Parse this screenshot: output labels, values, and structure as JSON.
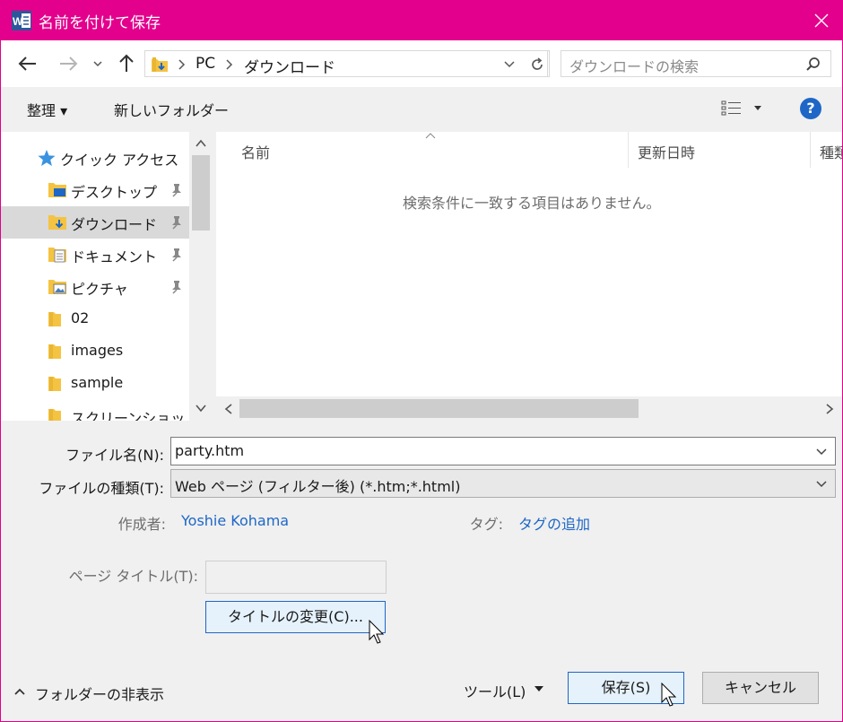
{
  "window": {
    "title": "名前を付けて保存",
    "accent_color": "#e3008c"
  },
  "nav": {
    "back_icon": "arrow-left-icon",
    "forward_icon": "arrow-right-icon",
    "recent_icon": "chevron-down-icon",
    "up_icon": "arrow-up-icon",
    "breadcrumb": [
      "PC",
      "ダウンロード"
    ],
    "search_placeholder": "ダウンロードの検索"
  },
  "toolbar": {
    "organize_label": "整理 ▾",
    "new_folder_label": "新しいフォルダー",
    "help_label": "?"
  },
  "sidebar": {
    "items": [
      {
        "label": "クイック アクセス",
        "icon": "star-icon",
        "pinned": false,
        "selected": false
      },
      {
        "label": "デスクトップ",
        "icon": "desktop-folder-icon",
        "pinned": true,
        "selected": false
      },
      {
        "label": "ダウンロード",
        "icon": "download-folder-icon",
        "pinned": true,
        "selected": true
      },
      {
        "label": "ドキュメント",
        "icon": "documents-folder-icon",
        "pinned": true,
        "selected": false
      },
      {
        "label": "ピクチャ",
        "icon": "pictures-folder-icon",
        "pinned": true,
        "selected": false
      },
      {
        "label": "02",
        "icon": "folder-icon",
        "pinned": false,
        "selected": false
      },
      {
        "label": "images",
        "icon": "folder-icon",
        "pinned": false,
        "selected": false
      },
      {
        "label": "sample",
        "icon": "folder-icon",
        "pinned": false,
        "selected": false
      },
      {
        "label": "スクリーンショット",
        "icon": "folder-icon",
        "pinned": false,
        "selected": false
      }
    ]
  },
  "filelist": {
    "columns": [
      "名前",
      "更新日時",
      "種類"
    ],
    "empty_message": "検索条件に一致する項目はありません。"
  },
  "form": {
    "filename_label": "ファイル名(N):",
    "filename_value": "party.htm",
    "filetype_label": "ファイルの種類(T):",
    "filetype_value": "Web ページ (フィルター後) (*.htm;*.html)",
    "author_label": "作成者:",
    "author_value": "Yoshie Kohama",
    "tags_label": "タグ:",
    "tags_value": "タグの追加",
    "page_title_label": "ページ タイトル(T):",
    "page_title_value": "",
    "change_title_button": "タイトルの変更(C)..."
  },
  "footer": {
    "hide_folders_label": "フォルダーの非表示",
    "tools_label": "ツール(L)",
    "save_button": "保存(S)",
    "cancel_button": "キャンセル"
  }
}
